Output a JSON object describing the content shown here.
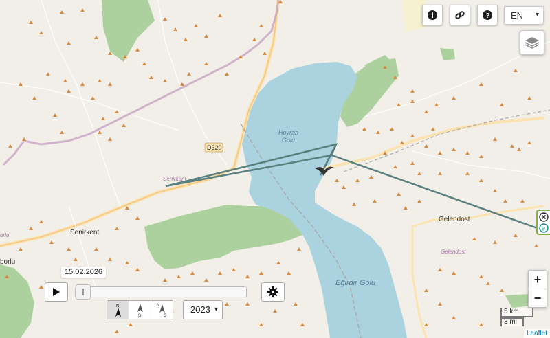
{
  "map": {
    "labels": {
      "lake_north_1": "Hoyran",
      "lake_north_2": "Golu",
      "lake_south": "Eğirdir Golu",
      "road": "D320",
      "senirkent_italic": "Senirkent",
      "senirkent": "Senirkent",
      "gelendost": "Gelendost",
      "gelendost_italic": "Gelendost",
      "borlu_1": "orlu",
      "borlu_2": "borlu"
    },
    "colors": {
      "water": "#aad3df",
      "land": "#f2efe9",
      "forest": "#add19e",
      "track": "#5a7f7f",
      "peak": "#d98a3c",
      "boundary": "#b48bb1",
      "road": "#f6c57f"
    }
  },
  "controls": {
    "info_icon": "info-icon",
    "link_icon": "link-icon",
    "help_icon": "help-icon",
    "language": "EN",
    "layers_icon": "layers-icon",
    "zoom_in": "+",
    "zoom_out": "−",
    "scale_km": "5 km",
    "scale_mi": "3 mi",
    "attribution": "Leaflet"
  },
  "timeline": {
    "date": "15.02.2026",
    "year": "2023",
    "progress_fraction": 0.0,
    "north_modes": [
      "N",
      "S",
      "N/S"
    ]
  }
}
